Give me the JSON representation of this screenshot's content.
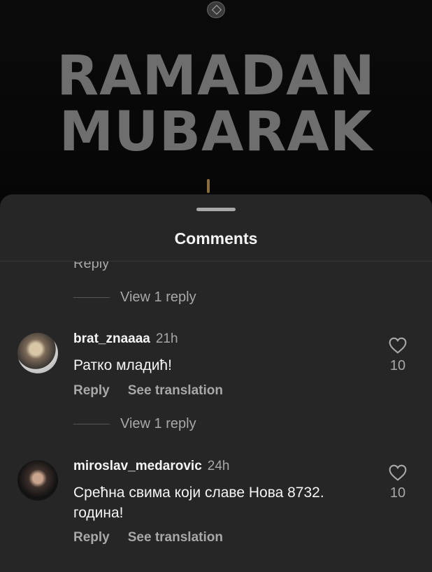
{
  "post": {
    "headline_line1": "RAMADAN",
    "headline_line2": "MUBARAK"
  },
  "sheet": {
    "title": "Comments"
  },
  "partial_reply_label": "Reply",
  "thread_1_view_replies": "View 1 reply",
  "comments": [
    {
      "username": "brat_znaaaa",
      "time": "21h",
      "text": "Ратко младић!",
      "reply_label": "Reply",
      "translate_label": "See translation",
      "likes": "10",
      "view_replies": "View 1 reply"
    },
    {
      "username": "miroslav_medarovic",
      "time": "24h",
      "text": "Срећна свима који славе Нова 8732. година!",
      "reply_label": "Reply",
      "translate_label": "See translation",
      "likes": "10"
    }
  ],
  "icons": {
    "like": "heart-outline-icon",
    "logo": "club-crest-icon"
  },
  "colors": {
    "sheet_bg": "#262626",
    "secondary_text": "#a8a8a8",
    "primary_text": "#f5f5f5"
  }
}
